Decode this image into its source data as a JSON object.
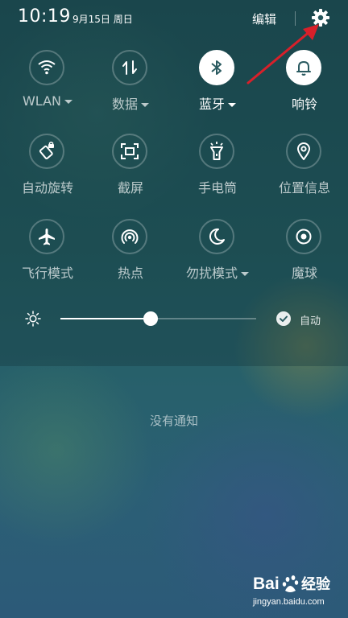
{
  "status_bar": {
    "time": "10:19",
    "date": "9月15日 周日",
    "edit_label": "编辑",
    "settings_icon": "gear-icon"
  },
  "quick_settings": {
    "tiles": [
      {
        "id": "wlan",
        "label": "WLAN",
        "icon": "wifi-icon",
        "active": false,
        "dropdown": true
      },
      {
        "id": "data",
        "label": "数据",
        "icon": "mobile-data-icon",
        "active": false,
        "dropdown": true
      },
      {
        "id": "bluetooth",
        "label": "蓝牙",
        "icon": "bluetooth-icon",
        "active": true,
        "dropdown": true
      },
      {
        "id": "ringer",
        "label": "响铃",
        "icon": "bell-icon",
        "active": true,
        "dropdown": false
      },
      {
        "id": "autorotate",
        "label": "自动旋转",
        "icon": "rotate-icon",
        "active": false,
        "dropdown": false
      },
      {
        "id": "screenshot",
        "label": "截屏",
        "icon": "screenshot-icon",
        "active": false,
        "dropdown": false
      },
      {
        "id": "flashlight",
        "label": "手电筒",
        "icon": "flashlight-icon",
        "active": false,
        "dropdown": false
      },
      {
        "id": "location",
        "label": "位置信息",
        "icon": "location-icon",
        "active": false,
        "dropdown": false
      },
      {
        "id": "airplane",
        "label": "飞行模式",
        "icon": "airplane-icon",
        "active": false,
        "dropdown": false
      },
      {
        "id": "hotspot",
        "label": "热点",
        "icon": "hotspot-icon",
        "active": false,
        "dropdown": false
      },
      {
        "id": "dnd",
        "label": "勿扰模式",
        "icon": "moon-icon",
        "active": false,
        "dropdown": true
      },
      {
        "id": "magicball",
        "label": "魔球",
        "icon": "ball-icon",
        "active": false,
        "dropdown": false
      }
    ],
    "brightness": {
      "level": 0.46,
      "auto_checked": true,
      "auto_label": "自动"
    }
  },
  "notifications": {
    "empty_text": "没有通知"
  },
  "watermark": {
    "brand": "Bai 经验",
    "url": "jingyan.baidu.com"
  },
  "colors": {
    "annotation_arrow": "#d8202a",
    "active_tile_bg": "#ffffff",
    "active_icon": "#2a5a60"
  }
}
